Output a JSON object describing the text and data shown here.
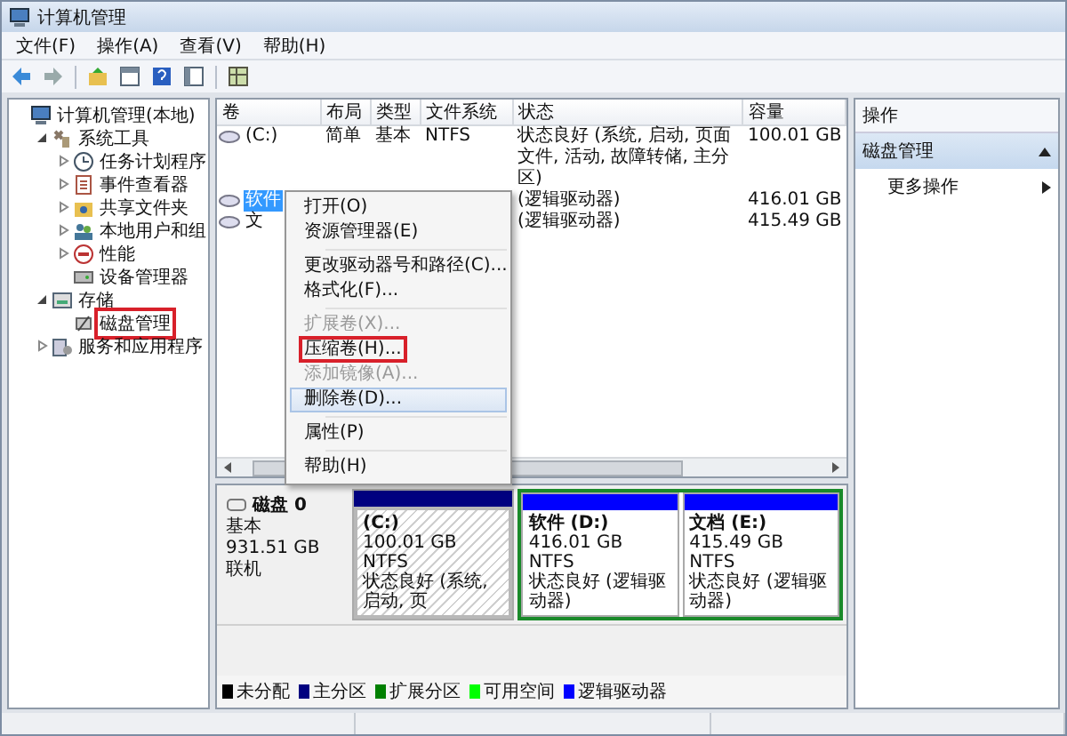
{
  "window": {
    "title": "计算机管理"
  },
  "menu_bar": [
    {
      "label": "文件(F)"
    },
    {
      "label": "操作(A)"
    },
    {
      "label": "查看(V)"
    },
    {
      "label": "帮助(H)"
    }
  ],
  "tree": [
    {
      "label": "计算机管理(本地)",
      "marked": false,
      "children": [
        {
          "label": "系统工具",
          "expanded": true,
          "marked": false,
          "children": [
            {
              "label": "任务计划程序",
              "expanded": false,
              "marked": false
            },
            {
              "label": "事件查看器",
              "expanded": false,
              "marked": false
            },
            {
              "label": "共享文件夹",
              "expanded": false,
              "marked": false
            },
            {
              "label": "本地用户和组",
              "expanded": false,
              "marked": false
            },
            {
              "label": "性能",
              "expanded": false,
              "marked": false
            },
            {
              "label": "设备管理器",
              "marked": false
            }
          ]
        },
        {
          "label": "存储",
          "expanded": true,
          "marked": false,
          "children": [
            {
              "label": "磁盘管理",
              "marked": true
            }
          ]
        },
        {
          "label": "服务和应用程序",
          "expanded": false,
          "marked": false
        }
      ]
    }
  ],
  "volume_table": {
    "columns": [
      "卷",
      "布局",
      "类型",
      "文件系统",
      "状态",
      "容量"
    ],
    "rows": [
      {
        "volume": "(C:)",
        "layout": "简单",
        "type": "基本",
        "file_system": "NTFS",
        "status": "状态良好 (系统, 启动, 页面文件, 活动, 故障转储, 主分区)",
        "capacity": "100.01 GB",
        "selected": false
      },
      {
        "volume": "软件",
        "status": "(逻辑驱动器)",
        "capacity": "416.01 GB",
        "selected": true
      },
      {
        "volume": "文",
        "status": "(逻辑驱动器)",
        "capacity": "415.49 GB",
        "selected": false
      }
    ]
  },
  "context_menu": [
    {
      "kind": "item",
      "label": "打开(O)",
      "disabled": false,
      "selected": false,
      "marked": false
    },
    {
      "kind": "item",
      "label": "资源管理器(E)",
      "disabled": false,
      "selected": false,
      "marked": false
    },
    {
      "kind": "separator"
    },
    {
      "kind": "item",
      "label": "更改驱动器号和路径(C)...",
      "disabled": false,
      "selected": false,
      "marked": false
    },
    {
      "kind": "item",
      "label": "格式化(F)...",
      "disabled": false,
      "selected": false,
      "marked": false
    },
    {
      "kind": "separator"
    },
    {
      "kind": "item",
      "label": "扩展卷(X)...",
      "disabled": true,
      "selected": false,
      "marked": false
    },
    {
      "kind": "item",
      "label": "压缩卷(H)...",
      "disabled": false,
      "selected": false,
      "marked": true
    },
    {
      "kind": "item",
      "label": "添加镜像(A)...",
      "disabled": true,
      "selected": false,
      "marked": false
    },
    {
      "kind": "item",
      "label": "删除卷(D)...",
      "disabled": false,
      "selected": true,
      "marked": false
    },
    {
      "kind": "separator"
    },
    {
      "kind": "item",
      "label": "属性(P)",
      "disabled": false,
      "selected": false,
      "marked": false
    },
    {
      "kind": "separator"
    },
    {
      "kind": "item",
      "label": "帮助(H)",
      "disabled": false,
      "selected": false,
      "marked": false
    }
  ],
  "disk": {
    "name": "磁盘 0",
    "type": "基本",
    "size": "931.51 GB",
    "state": "联机",
    "partitions": [
      {
        "kind": "primary",
        "hatched": true,
        "name": "(C:)",
        "size": "100.01 GB NTFS",
        "status": "状态良好 (系统, 启动, 页"
      },
      {
        "kind": "logical",
        "hatched": false,
        "name": "软件 (D:)",
        "size": "416.01 GB NTFS",
        "status": "状态良好 (逻辑驱动器)"
      },
      {
        "kind": "logical",
        "hatched": false,
        "name": "文档 (E:)",
        "size": "415.49 GB NTFS",
        "status": "状态良好 (逻辑驱动器)"
      }
    ]
  },
  "legend": [
    {
      "label": "未分配",
      "color": "#000000"
    },
    {
      "label": "主分区",
      "color": "#000080"
    },
    {
      "label": "扩展分区",
      "color": "#008000"
    },
    {
      "label": "可用空间",
      "color": "#00ff00"
    },
    {
      "label": "逻辑驱动器",
      "color": "#0000ff"
    }
  ],
  "actions": {
    "title": "操作",
    "sections": [
      {
        "label": "磁盘管理",
        "expanded": true,
        "items": [
          {
            "label": "更多操作"
          }
        ]
      }
    ]
  }
}
